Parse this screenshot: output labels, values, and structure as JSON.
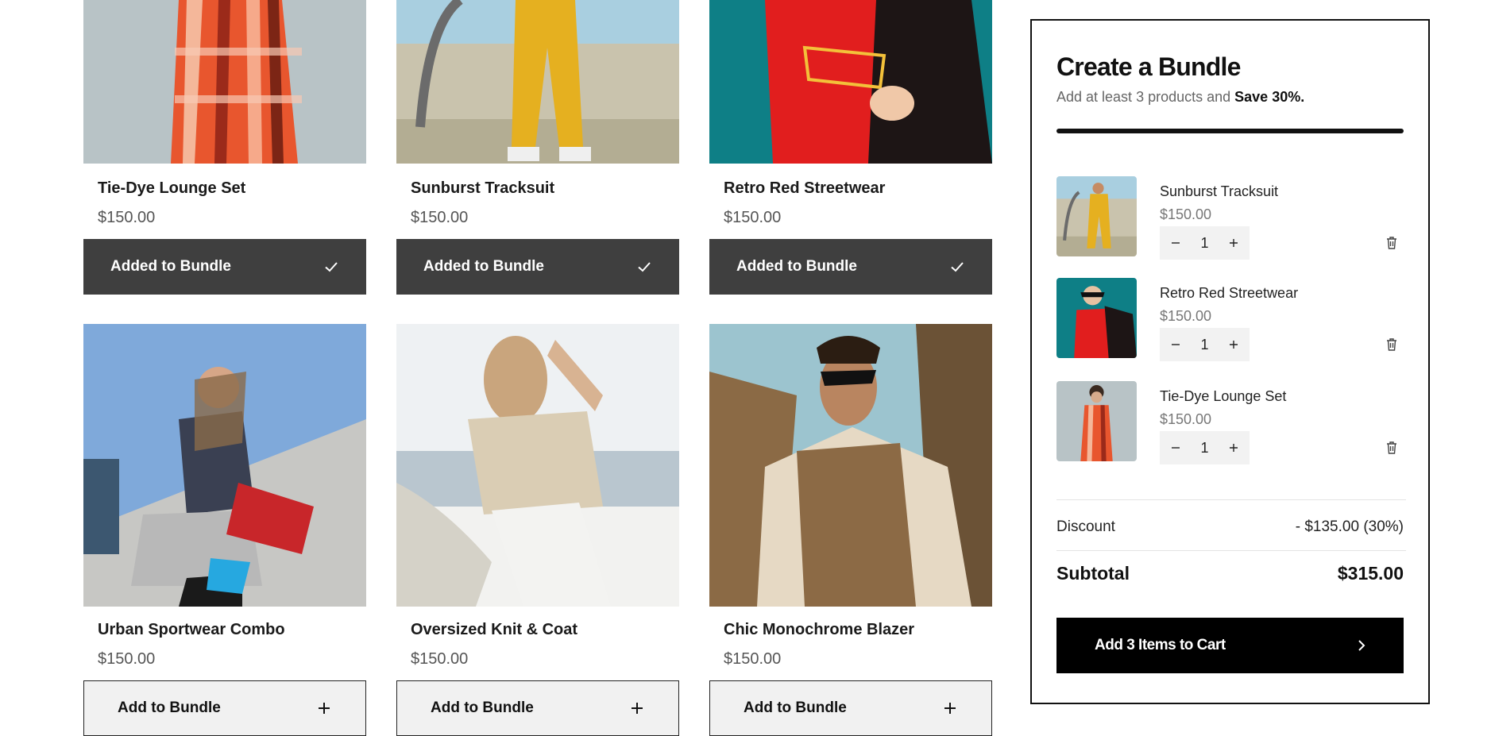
{
  "products_row1": [
    {
      "name": "Tie-Dye Lounge Set",
      "price": "$150.00",
      "button": "Added to Bundle"
    },
    {
      "name": "Sunburst Tracksuit",
      "price": "$150.00",
      "button": "Added to Bundle"
    },
    {
      "name": "Retro Red Streetwear",
      "price": "$150.00",
      "button": "Added to Bundle"
    }
  ],
  "products_row2": [
    {
      "name": "Urban Sportwear Combo",
      "price": "$150.00",
      "button": "Add to Bundle"
    },
    {
      "name": "Oversized Knit & Coat",
      "price": "$150.00",
      "button": "Add to Bundle"
    },
    {
      "name": "Chic Monochrome Blazer",
      "price": "$150.00",
      "button": "Add to Bundle"
    }
  ],
  "bundle": {
    "title": "Create a Bundle",
    "subtitle_prefix": "Add at least 3 products and ",
    "subtitle_bold": "Save 30%.",
    "progress": 1.0,
    "items": [
      {
        "name": "Sunburst Tracksuit",
        "price": "$150.00",
        "qty": "1"
      },
      {
        "name": "Retro Red Streetwear",
        "price": "$150.00",
        "qty": "1"
      },
      {
        "name": "Tie-Dye Lounge Set",
        "price": "$150.00",
        "qty": "1"
      }
    ],
    "discount_label": "Discount",
    "discount_value": "- $135.00 (30%)",
    "subtotal_label": "Subtotal",
    "subtotal_value": "$315.00",
    "cart_button": "Add 3 Items to Cart"
  },
  "icons": {
    "added": "check-icon",
    "add": "plus-icon",
    "qty_minus": "minus-icon",
    "qty_plus": "plus-icon",
    "remove": "trash-icon",
    "cart_arrow": "chevron-right-icon"
  },
  "colors": {
    "added_button_bg": "#3f3f3f",
    "add_button_bg": "#f1f1f1",
    "cart_button_bg": "#000000"
  }
}
